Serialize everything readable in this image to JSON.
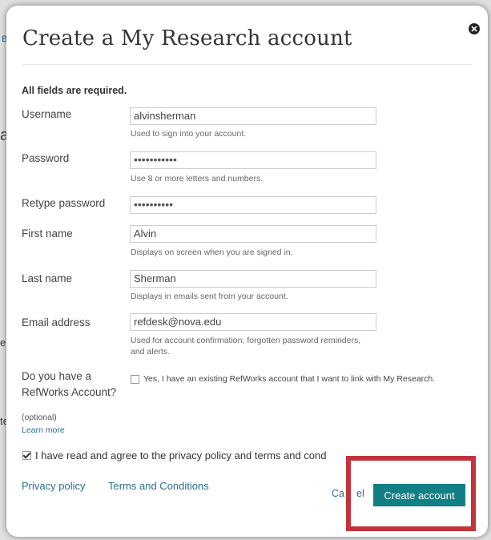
{
  "background": {
    "fragments": [
      "Br",
      "a",
      "e i",
      "te"
    ]
  },
  "modal": {
    "title": "Create a My Research account",
    "required_note": "All fields are required."
  },
  "fields": {
    "username": {
      "label": "Username",
      "value": "alvinsherman",
      "hint": "Used to sign into your account."
    },
    "password": {
      "label": "Password",
      "value": "•••••••••••",
      "hint": "Use 8 or more letters and numbers."
    },
    "retype_password": {
      "label": "Retype password",
      "value": "••••••••••"
    },
    "first_name": {
      "label": "First name",
      "value": "Alvin",
      "hint": "Displays on screen when you are signed in."
    },
    "last_name": {
      "label": "Last name",
      "value": "Sherman",
      "hint": "Displays in emails sent from your account."
    },
    "email": {
      "label": "Email address",
      "value": "refdesk@nova.edu",
      "hint_line1": "Used for account confirmation, forgotten password reminders,",
      "hint_line2": "and alerts."
    }
  },
  "refworks": {
    "question_line1": "Do you have a",
    "question_line2": "RefWorks Account?",
    "optional": "(optional)",
    "learn_more": "Learn more",
    "checkbox_label": "Yes, I have an existing RefWorks account that I want to link with My Research.",
    "checked": false
  },
  "agreement": {
    "label": "I have read and agree to the privacy policy and terms and cond",
    "checked": true
  },
  "footer": {
    "privacy_policy": "Privacy policy",
    "terms": "Terms and Conditions",
    "cancel_part1": "Ca",
    "cancel_part2": "el",
    "create_account": "Create account"
  },
  "colors": {
    "primary_button": "#127f86",
    "link": "#2a6f8f",
    "highlight": "#c1343b"
  }
}
